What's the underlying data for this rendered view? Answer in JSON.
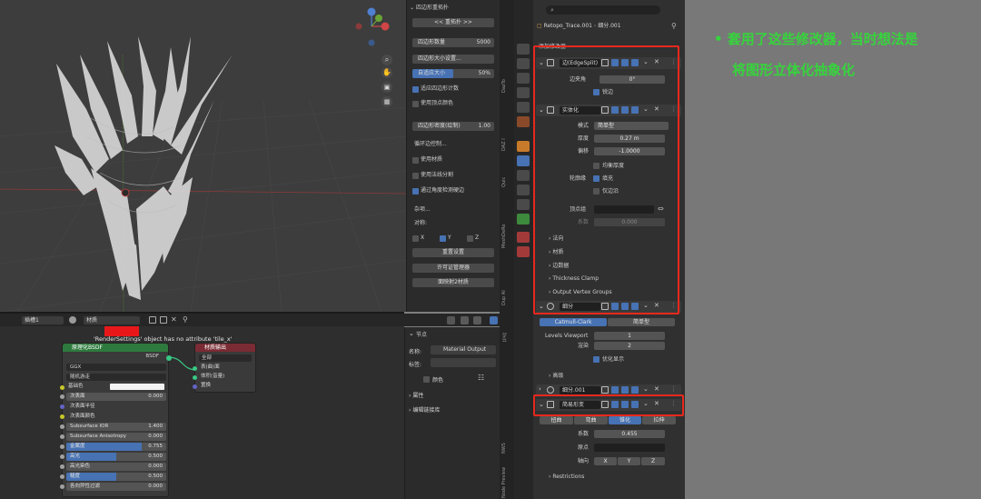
{
  "npanel": {
    "title": "四边形重拓扑",
    "retopo_btn": "<< 重拓扑 >>",
    "quad_count_label": "四边形数量",
    "quad_count_value": "5000",
    "size_setting": "四边形大小设置...",
    "adaptive_size_label": "自适应大小",
    "adaptive_size_value": "50%",
    "adaptive_quad": "适应四边形计数",
    "vertex_color": "使用顶点颜色",
    "density_label": "四边形密度(绘制)",
    "density_value": "1.00",
    "edge_loop": "循环边控制...",
    "use_material": "使用材质",
    "use_normal_split": "使用法线分割",
    "angle_detect": "通过角度检测硬边",
    "misc": "杂项...",
    "symmetry": "对称:",
    "axis_x": "X",
    "axis_y": "Y",
    "axis_z": "Z",
    "reset": "重置设置",
    "license": "许可证管理器",
    "remap": "面映射2材质"
  },
  "viewport_tabs": [
    "DazTo",
    "DAZ I",
    "Quic",
    "MeshDeRo",
    "Dup AI"
  ],
  "node_tabs": [
    "节点",
    "NWS",
    "Node Preview"
  ],
  "properties": {
    "object_name": "Retopo_Trace.001",
    "modifier_name": "细分.001",
    "add_modifier": "添加修改器",
    "mods": {
      "edgesplit": {
        "name": "边(EdgeSplit)",
        "angle_label": "边夹角",
        "angle_value": "0°",
        "sharp": "锐边"
      },
      "solidify": {
        "name": "实体化",
        "mode_label": "模式",
        "mode_value": "简单型",
        "thickness_label": "厚度",
        "thickness_value": "0.27 m",
        "offset_label": "偏移",
        "offset_value": "-1.0000",
        "even": "均衡厚度",
        "rim_label": "轮廓缘",
        "fill": "填充",
        "rim_only": "仅边沿",
        "vgroup_label": "顶点组",
        "factor_label": "系数",
        "factor_value": "0.000",
        "normals": "法向",
        "materials": "材质",
        "edge_data": "边数据",
        "thickness_clamp": "Thickness Clamp",
        "output_groups": "Output Vertex Groups"
      },
      "subdiv": {
        "name": "细分",
        "catmull": "Catmull-Clark",
        "simple": "简单型",
        "levels_vp_label": "Levels Viewport",
        "levels_vp_value": "1",
        "render_label": "渲染",
        "render_value": "2",
        "optimal": "优化显示",
        "advanced": "高级"
      },
      "subdiv2": {
        "name": "细分.001"
      },
      "deform": {
        "name": "简易形变",
        "tabs": [
          "扭曲",
          "弯曲",
          "锥化",
          "拉伸"
        ],
        "factor_label": "系数",
        "factor_value": "0.455",
        "origin_label": "原点",
        "axis_label": "轴向",
        "axes": [
          "X",
          "Y",
          "Z"
        ],
        "restrictions": "Restrictions"
      }
    }
  },
  "node_header": {
    "slot": "插槽1",
    "material": "材质"
  },
  "error_text": "'RenderSettings' object has no attribute 'tile_x'",
  "bsdf": {
    "title": "原理化BSDF",
    "out": "BSDF",
    "dist": "GGX",
    "sss": "随机游走",
    "base_color": "基础色",
    "rows": [
      {
        "label": "次表面",
        "value": "0.000",
        "fill": 0
      },
      {
        "label": "次表面半径",
        "value": "",
        "fill": 0
      },
      {
        "label": "次表面颜色",
        "value": "",
        "fill": 0
      },
      {
        "label": "Subsurface IOR",
        "value": "1.400",
        "fill": 0
      },
      {
        "label": "Subsurface Anisotropy",
        "value": "0.000",
        "fill": 0
      },
      {
        "label": "金属度",
        "value": "0.755",
        "fill": 0.755
      },
      {
        "label": "高光",
        "value": "0.500",
        "fill": 0.5
      },
      {
        "label": "高光染色",
        "value": "0.000",
        "fill": 0
      },
      {
        "label": "糙度",
        "value": "0.500",
        "fill": 0.5
      },
      {
        "label": "各向异性过滤",
        "value": "0.000",
        "fill": 0
      }
    ]
  },
  "output_node": {
    "title": "材质输出",
    "target": "全部",
    "surface": "表(曲)面",
    "volume": "体积(音量)",
    "displace": "置换"
  },
  "node_side": {
    "title": "节点",
    "name_label": "名称:",
    "name_value": "Material Output",
    "label_label": "标签:",
    "color": "颜色",
    "props": "属性",
    "tree": "编辑链接库"
  },
  "annotation": {
    "line1": "• 套用了这些修改器，当时想法是",
    "line2": "将图形立体化抽象化",
    "color": "#36d43c"
  }
}
